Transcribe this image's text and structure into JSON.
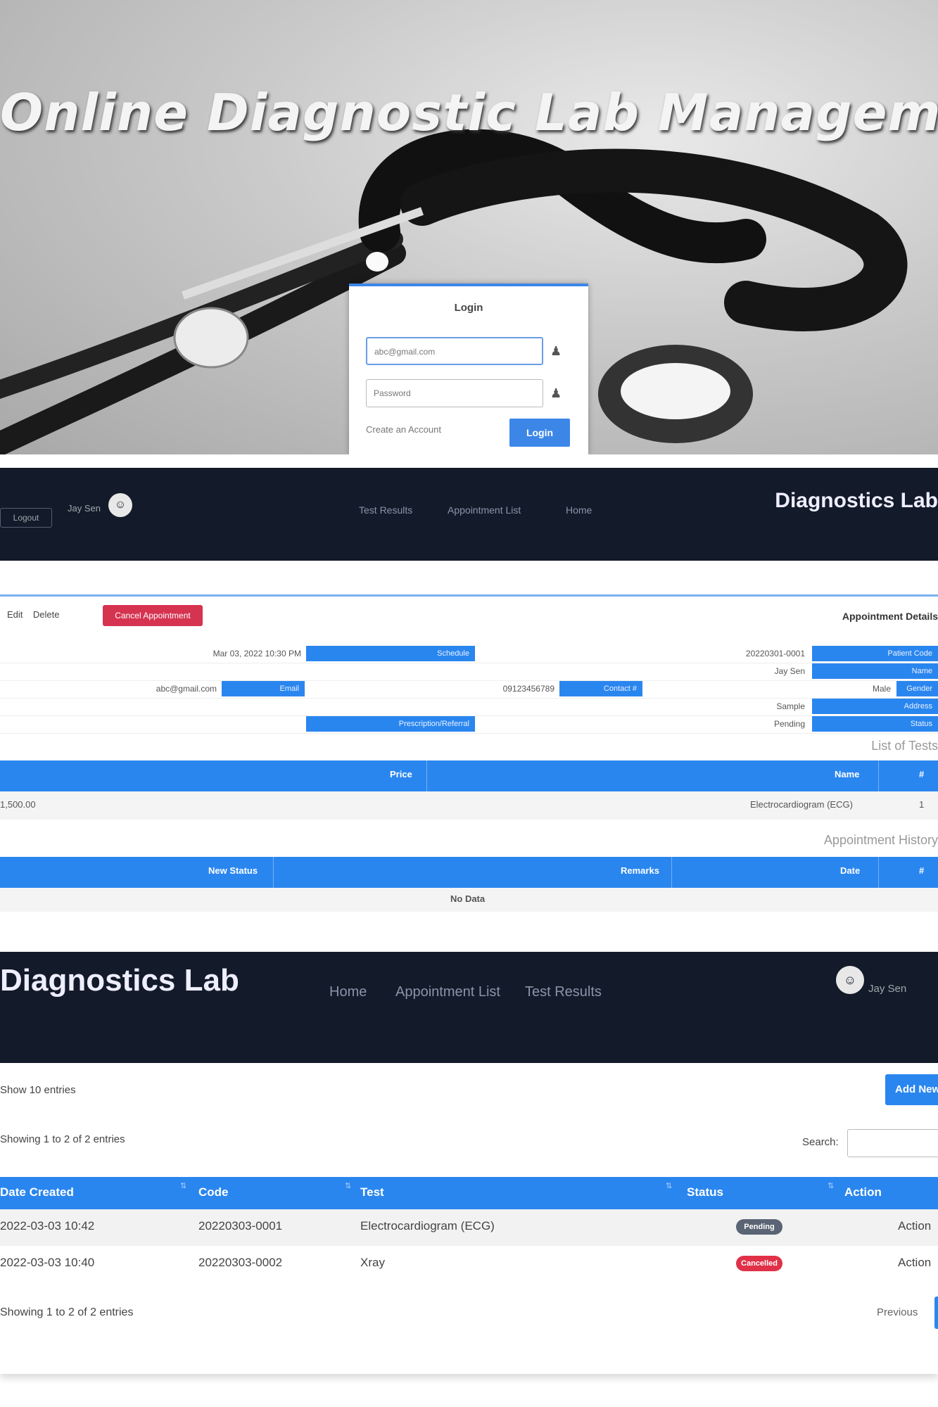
{
  "login_screen": {
    "title": "Online Diagnostic Lab Management System",
    "form_title": "Login",
    "email_value": "abc@gmail.com",
    "password_placeholder": "Password",
    "create_account_link": "Create an Account",
    "login_button": "Login"
  },
  "appointment_screen": {
    "brand": "Diagnostics Lab",
    "nav": [
      "Home",
      "Appointment List",
      "Test Results"
    ],
    "user_name": "Jay Sen",
    "logout_button": "Logout",
    "card_title": "Appointment Details",
    "cancel_button": "Cancel Appointment",
    "card_tools": [
      "Edit",
      "Delete"
    ],
    "fields": [
      {
        "label": "Patient Code",
        "value": "20220301-0001"
      },
      {
        "label": "Name",
        "value": "Jay Sen"
      },
      {
        "label": "Gender",
        "value": "Male"
      },
      {
        "label": "Address",
        "value": "Sample"
      },
      {
        "label": "Status",
        "value": "Pending"
      },
      {
        "label": "Schedule",
        "value": "Mar 03, 2022 10:30 PM"
      },
      {
        "label": "Contact #",
        "value": "09123456789"
      },
      {
        "label": "Email",
        "value": "abc@gmail.com"
      },
      {
        "label": "Prescription/Referral",
        "value": ""
      }
    ],
    "tests_heading": "List of Tests",
    "tests_table": {
      "headers": [
        "#",
        "Name",
        "Price"
      ],
      "rows": [
        [
          "1",
          "Electrocardiogram (ECG)",
          "1,500.00"
        ]
      ]
    },
    "history_heading": "Appointment History",
    "history_table": {
      "headers": [
        "#",
        "Date",
        "Remarks",
        "New Status"
      ],
      "empty_text": "No Data"
    }
  },
  "results_screen": {
    "brand": "Diagnostics Lab",
    "nav": [
      "Home",
      "Appointment List",
      "Test Results"
    ],
    "user_name": "Jay Sen",
    "length_menu": "Show 10 entries",
    "add_button": "Add New",
    "info_text": "Showing 1 to 2 of 2 entries",
    "search_label": "Search:",
    "table_headers": [
      "Date Created",
      "Code",
      "Test",
      "Status",
      "Action"
    ],
    "rows": [
      {
        "date": "2022-03-03 10:42",
        "code": "20220303-0001",
        "test": "Electrocardiogram (ECG)",
        "status": "Pending",
        "action": "Action"
      },
      {
        "date": "2022-03-03 10:40",
        "code": "20220303-0002",
        "test": "Xray",
        "status": "Cancelled",
        "action": "Action"
      }
    ],
    "page_info": "Showing 1 to 2 of 2 entries",
    "pagination_label": "Previous"
  }
}
